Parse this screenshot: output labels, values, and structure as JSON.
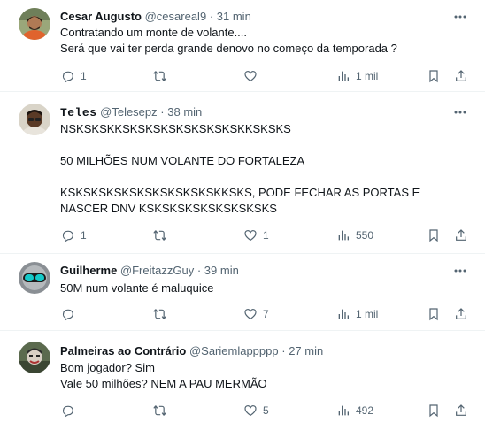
{
  "tweets": [
    {
      "name": "Cesar Augusto",
      "handle": "@cesareal9",
      "sep": "·",
      "time": "31 min",
      "lines": [
        "Contratando um monte de volante....",
        "Será que vai ter perda grande denovo no começo da temporada ?"
      ],
      "replies": "1",
      "retweets": "",
      "likes": "",
      "views": "1 mil"
    },
    {
      "name": "Teles",
      "handle": "@Telesepz",
      "sep": "·",
      "time": "38 min",
      "lines": [
        "NSKSKSKKSKSKSKSKSKSKSKSKKSKSKS",
        "",
        "50 MILHÕES NUM VOLANTE DO FORTALEZA",
        "",
        "KSKSKSKSKSKSKSKSKSKSKKSKS, PODE FECHAR AS PORTAS E NASCER DNV KSKSKSKSKSKSKSKSKS"
      ],
      "replies": "1",
      "retweets": "",
      "likes": "1",
      "views": "550"
    },
    {
      "name": "Guilherme",
      "handle": "@FreitazzGuy",
      "sep": "·",
      "time": "39 min",
      "lines": [
        "50M num volante é maluquice"
      ],
      "replies": "",
      "retweets": "",
      "likes": "7",
      "views": "1 mil"
    },
    {
      "name": "Palmeiras ao Contrário",
      "handle": "@Sariemlappppp",
      "sep": "·",
      "time": "27 min",
      "lines": [
        "Bom jogador? Sim",
        "Vale 50 milhões? NEM A PAU MERMÃO"
      ],
      "replies": "",
      "retweets": "",
      "likes": "5",
      "views": "492"
    }
  ],
  "icons": {
    "more": "more-horizontal-icon",
    "reply": "reply-icon",
    "retweet": "retweet-icon",
    "like": "heart-icon",
    "views": "views-chart-icon",
    "bookmark": "bookmark-icon",
    "share": "share-icon"
  },
  "colors": {
    "text": "#0f1419",
    "muted": "#536471",
    "divider": "#eff3f4"
  }
}
